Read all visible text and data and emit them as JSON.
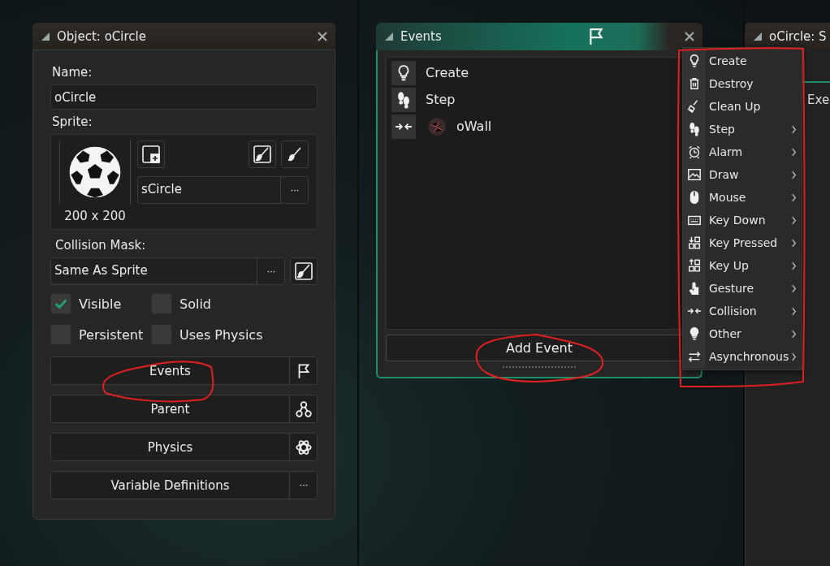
{
  "object_window": {
    "title": "Object: oCircle",
    "name_label": "Name:",
    "name_value": "oCircle",
    "sprite_label": "Sprite:",
    "sprite_size": "200 x 200",
    "sprite_value": "sCircle",
    "collision_mask_label": "Collision Mask:",
    "collision_mask_value": "Same As Sprite",
    "checkboxes": [
      {
        "label": "Visible",
        "checked": true
      },
      {
        "label": "Solid",
        "checked": false
      },
      {
        "label": "Persistent",
        "checked": false
      },
      {
        "label": "Uses Physics",
        "checked": false
      }
    ],
    "buttons": [
      {
        "kind": "events",
        "label": "Events"
      },
      {
        "kind": "parent",
        "label": "Parent"
      },
      {
        "kind": "physics",
        "label": "Physics"
      },
      {
        "kind": "variables",
        "label": "Variable Definitions"
      }
    ]
  },
  "events_window": {
    "title": "Events",
    "events": [
      {
        "kind": "create",
        "label": "Create"
      },
      {
        "kind": "step",
        "label": "Step"
      },
      {
        "kind": "collision",
        "label": "oWall"
      }
    ],
    "add_button": "Add Event"
  },
  "event_menu": [
    {
      "kind": "create",
      "label": "Create",
      "has_submenu": false
    },
    {
      "kind": "destroy",
      "label": "Destroy",
      "has_submenu": false
    },
    {
      "kind": "cleanup",
      "label": "Clean Up",
      "has_submenu": false
    },
    {
      "kind": "step",
      "label": "Step",
      "has_submenu": true
    },
    {
      "kind": "alarm",
      "label": "Alarm",
      "has_submenu": true
    },
    {
      "kind": "draw",
      "label": "Draw",
      "has_submenu": true
    },
    {
      "kind": "mouse",
      "label": "Mouse",
      "has_submenu": true
    },
    {
      "kind": "keydown",
      "label": "Key Down",
      "has_submenu": true
    },
    {
      "kind": "keypressed",
      "label": "Key Pressed",
      "has_submenu": true
    },
    {
      "kind": "keyup",
      "label": "Key Up",
      "has_submenu": true
    },
    {
      "kind": "gesture",
      "label": "Gesture",
      "has_submenu": true
    },
    {
      "kind": "collision",
      "label": "Collision",
      "has_submenu": true
    },
    {
      "kind": "other",
      "label": "Other",
      "has_submenu": true
    },
    {
      "kind": "async",
      "label": "Asynchronous",
      "has_submenu": true
    }
  ],
  "third_window": {
    "title": "oCircle: S",
    "text": "Exe"
  }
}
